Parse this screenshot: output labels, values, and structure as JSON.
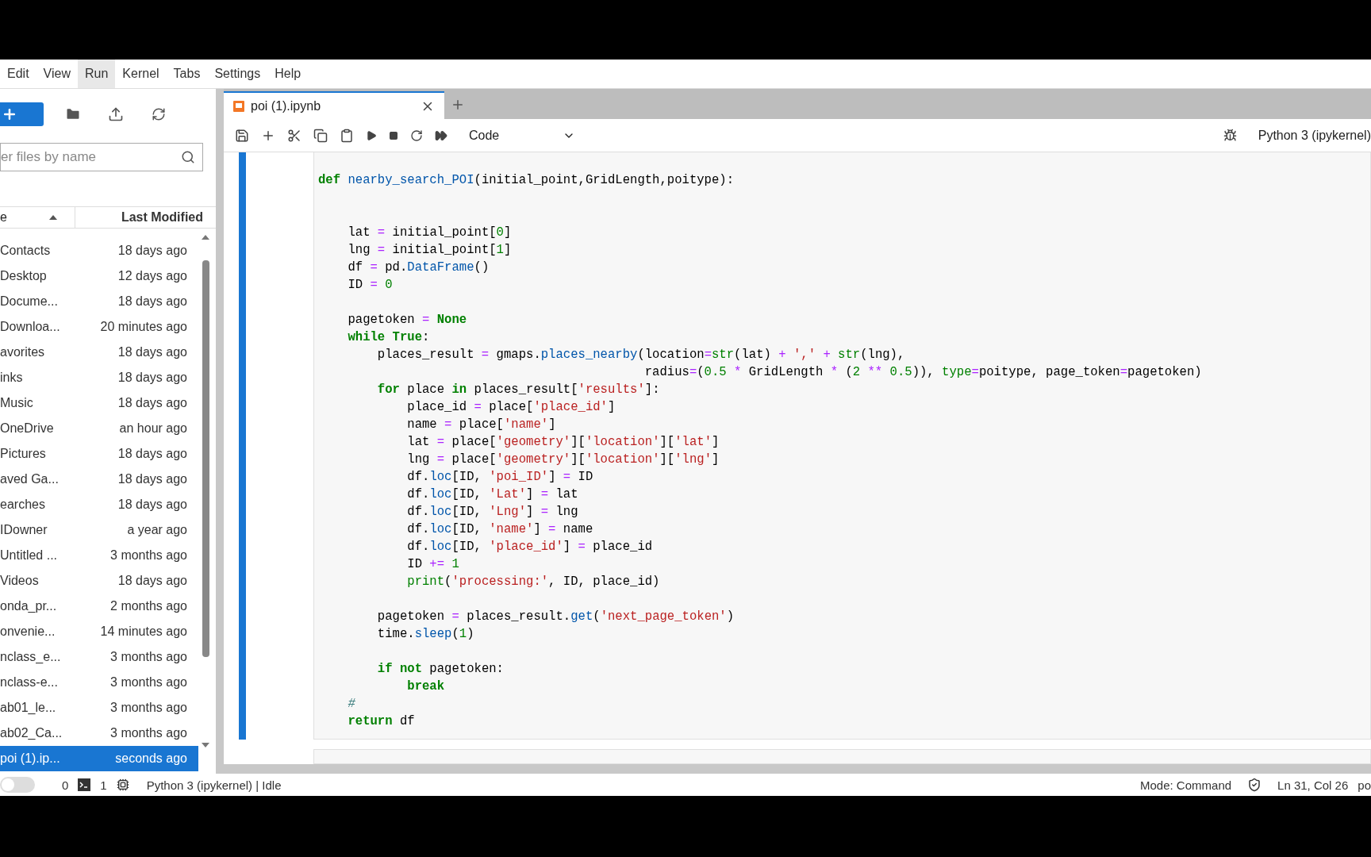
{
  "menu": [
    {
      "label": "Edit",
      "selected": false
    },
    {
      "label": "View",
      "selected": false
    },
    {
      "label": "Run",
      "selected": true
    },
    {
      "label": "Kernel",
      "selected": false
    },
    {
      "label": "Tabs",
      "selected": false
    },
    {
      "label": "Settings",
      "selected": false
    },
    {
      "label": "Help",
      "selected": false
    }
  ],
  "file_browser": {
    "filter": {
      "placeholder": "er files by name"
    },
    "columns": [
      "e",
      "Last Modified"
    ],
    "files": [
      {
        "name": "Contacts",
        "modified": "18 days ago",
        "selected": false
      },
      {
        "name": "Desktop",
        "modified": "12 days ago",
        "selected": false
      },
      {
        "name": "Docume...",
        "modified": "18 days ago",
        "selected": false
      },
      {
        "name": "Downloa...",
        "modified": "20 minutes ago",
        "selected": false
      },
      {
        "name": "avorites",
        "modified": "18 days ago",
        "selected": false
      },
      {
        "name": "inks",
        "modified": "18 days ago",
        "selected": false
      },
      {
        "name": "Music",
        "modified": "18 days ago",
        "selected": false
      },
      {
        "name": "OneDrive",
        "modified": "an hour ago",
        "selected": false
      },
      {
        "name": "Pictures",
        "modified": "18 days ago",
        "selected": false
      },
      {
        "name": "aved Ga...",
        "modified": "18 days ago",
        "selected": false
      },
      {
        "name": "earches",
        "modified": "18 days ago",
        "selected": false
      },
      {
        "name": "IDowner",
        "modified": "a year ago",
        "selected": false
      },
      {
        "name": "Untitled ...",
        "modified": "3 months ago",
        "selected": false
      },
      {
        "name": "Videos",
        "modified": "18 days ago",
        "selected": false
      },
      {
        "name": "onda_pr...",
        "modified": "2 months ago",
        "selected": false
      },
      {
        "name": "onvenie...",
        "modified": "14 minutes ago",
        "selected": false
      },
      {
        "name": "nclass_e...",
        "modified": "3 months ago",
        "selected": false
      },
      {
        "name": "nclass-e...",
        "modified": "3 months ago",
        "selected": false
      },
      {
        "name": "ab01_le...",
        "modified": "3 months ago",
        "selected": false
      },
      {
        "name": "ab02_Ca...",
        "modified": "3 months ago",
        "selected": false
      },
      {
        "name": "poi (1).ip...",
        "modified": "seconds ago",
        "selected": true
      }
    ]
  },
  "tab": {
    "title": "poi (1).ipynb"
  },
  "toolbar": {
    "cell_type": "Code",
    "kernel": "Python 3 (ipykernel)"
  },
  "cell": {
    "lines": [
      {
        "segments": [
          {
            "text": "def",
            "kind": "keyword"
          },
          {
            "text": " nearby_search_POI",
            "kind": "name"
          },
          {
            "text": "(initial_point,GridLength,poitype):",
            "kind": "plain"
          }
        ]
      },
      {
        "kind": "double_spaced",
        "segments": [
          {
            "text": "    lat",
            "kind": "plain"
          },
          {
            "text": " =",
            "kind": "operator"
          },
          {
            "text": " initial_point[",
            "kind": "plain"
          },
          {
            "text": "0",
            "kind": "number"
          },
          {
            "text": "]",
            "kind": "plain"
          }
        ]
      },
      {
        "segments": [
          {
            "text": "    lng",
            "kind": "plain"
          },
          {
            "text": " =",
            "kind": "operator"
          },
          {
            "text": " initial_point[",
            "kind": "plain"
          },
          {
            "text": "1",
            "kind": "number"
          },
          {
            "text": "]",
            "kind": "plain"
          }
        ]
      },
      {
        "segments": [
          {
            "text": "    df",
            "kind": "plain"
          },
          {
            "text": " =",
            "kind": "operator"
          },
          {
            "text": " pd.",
            "kind": "plain"
          },
          {
            "text": "DataFrame",
            "kind": "name"
          },
          {
            "text": "()",
            "kind": "plain"
          }
        ]
      },
      {
        "segments": [
          {
            "text": "    ID",
            "kind": "plain"
          },
          {
            "text": " =",
            "kind": "operator"
          },
          {
            "text": " 0",
            "kind": "number"
          }
        ]
      },
      {
        "kind": "spaced",
        "segments": [
          {
            "text": "    pagetoken",
            "kind": "plain"
          },
          {
            "text": " =",
            "kind": "operator"
          },
          {
            "text": " None",
            "kind": "keyword"
          }
        ]
      },
      {
        "segments": [
          {
            "text": "    while",
            "kind": "keyword"
          },
          {
            "text": " True",
            "kind": "keyword"
          },
          {
            "text": ":",
            "kind": "plain"
          }
        ]
      },
      {
        "segments": [
          {
            "text": "        places_result",
            "kind": "plain"
          },
          {
            "text": " =",
            "kind": "operator"
          },
          {
            "text": " gmaps.",
            "kind": "plain"
          },
          {
            "text": "places_nearby",
            "kind": "name"
          },
          {
            "text": "(location",
            "kind": "plain"
          },
          {
            "text": "=",
            "kind": "operator"
          },
          {
            "text": "str",
            "kind": "builtin"
          },
          {
            "text": "(lat)",
            "kind": "plain"
          },
          {
            "text": " +",
            "kind": "operator"
          },
          {
            "text": " ','",
            "kind": "string"
          },
          {
            "text": " +",
            "kind": "operator"
          },
          {
            "text": " str",
            "kind": "builtin"
          },
          {
            "text": "(lng),",
            "kind": "plain"
          }
        ]
      },
      {
        "segments": [
          {
            "text": "                                            radius",
            "kind": "plain"
          },
          {
            "text": "=",
            "kind": "operator"
          },
          {
            "text": "(",
            "kind": "plain"
          },
          {
            "text": "0.5",
            "kind": "number"
          },
          {
            "text": " *",
            "kind": "operator"
          },
          {
            "text": " GridLength",
            "kind": "plain"
          },
          {
            "text": " *",
            "kind": "operator"
          },
          {
            "text": " (",
            "kind": "plain"
          },
          {
            "text": "2",
            "kind": "number"
          },
          {
            "text": " **",
            "kind": "operator"
          },
          {
            "text": " 0.5",
            "kind": "number"
          },
          {
            "text": ")),",
            "kind": "plain"
          },
          {
            "text": " type",
            "kind": "builtin"
          },
          {
            "text": "=",
            "kind": "operator"
          },
          {
            "text": "poitype, page_token",
            "kind": "plain"
          },
          {
            "text": "=",
            "kind": "operator"
          },
          {
            "text": "pagetoken)",
            "kind": "plain"
          }
        ]
      },
      {
        "segments": [
          {
            "text": "        for",
            "kind": "keyword"
          },
          {
            "text": " place",
            "kind": "plain"
          },
          {
            "text": " in",
            "kind": "keyword"
          },
          {
            "text": " places_result[",
            "kind": "plain"
          },
          {
            "text": "'results'",
            "kind": "string"
          },
          {
            "text": "]:",
            "kind": "plain"
          }
        ]
      },
      {
        "segments": [
          {
            "text": "            place_id",
            "kind": "plain"
          },
          {
            "text": " =",
            "kind": "operator"
          },
          {
            "text": " place[",
            "kind": "plain"
          },
          {
            "text": "'place_id'",
            "kind": "string"
          },
          {
            "text": "]",
            "kind": "plain"
          }
        ]
      },
      {
        "segments": [
          {
            "text": "            name",
            "kind": "plain"
          },
          {
            "text": " =",
            "kind": "operator"
          },
          {
            "text": " place[",
            "kind": "plain"
          },
          {
            "text": "'name'",
            "kind": "string"
          },
          {
            "text": "]",
            "kind": "plain"
          }
        ]
      },
      {
        "segments": [
          {
            "text": "            lat",
            "kind": "plain"
          },
          {
            "text": " =",
            "kind": "operator"
          },
          {
            "text": " place[",
            "kind": "plain"
          },
          {
            "text": "'geometry'",
            "kind": "string"
          },
          {
            "text": "][",
            "kind": "plain"
          },
          {
            "text": "'location'",
            "kind": "string"
          },
          {
            "text": "][",
            "kind": "plain"
          },
          {
            "text": "'lat'",
            "kind": "string"
          },
          {
            "text": "]",
            "kind": "plain"
          }
        ]
      },
      {
        "segments": [
          {
            "text": "            lng",
            "kind": "plain"
          },
          {
            "text": " =",
            "kind": "operator"
          },
          {
            "text": " place[",
            "kind": "plain"
          },
          {
            "text": "'geometry'",
            "kind": "string"
          },
          {
            "text": "][",
            "kind": "plain"
          },
          {
            "text": "'location'",
            "kind": "string"
          },
          {
            "text": "][",
            "kind": "plain"
          },
          {
            "text": "'lng'",
            "kind": "string"
          },
          {
            "text": "]",
            "kind": "plain"
          }
        ]
      },
      {
        "segments": [
          {
            "text": "            df.",
            "kind": "plain"
          },
          {
            "text": "loc",
            "kind": "name"
          },
          {
            "text": "[ID,",
            "kind": "plain"
          },
          {
            "text": " 'poi_ID'",
            "kind": "string"
          },
          {
            "text": "]",
            "kind": "plain"
          },
          {
            "text": " =",
            "kind": "operator"
          },
          {
            "text": " ID",
            "kind": "plain"
          }
        ]
      },
      {
        "segments": [
          {
            "text": "            df.",
            "kind": "plain"
          },
          {
            "text": "loc",
            "kind": "name"
          },
          {
            "text": "[ID,",
            "kind": "plain"
          },
          {
            "text": " 'Lat'",
            "kind": "string"
          },
          {
            "text": "]",
            "kind": "plain"
          },
          {
            "text": " =",
            "kind": "operator"
          },
          {
            "text": " lat",
            "kind": "plain"
          }
        ]
      },
      {
        "segments": [
          {
            "text": "            df.",
            "kind": "plain"
          },
          {
            "text": "loc",
            "kind": "name"
          },
          {
            "text": "[ID,",
            "kind": "plain"
          },
          {
            "text": " 'Lng'",
            "kind": "string"
          },
          {
            "text": "]",
            "kind": "plain"
          },
          {
            "text": " =",
            "kind": "operator"
          },
          {
            "text": " lng",
            "kind": "plain"
          }
        ]
      },
      {
        "segments": [
          {
            "text": "            df.",
            "kind": "plain"
          },
          {
            "text": "loc",
            "kind": "name"
          },
          {
            "text": "[ID,",
            "kind": "plain"
          },
          {
            "text": " 'name'",
            "kind": "string"
          },
          {
            "text": "]",
            "kind": "plain"
          },
          {
            "text": " =",
            "kind": "operator"
          },
          {
            "text": " name",
            "kind": "plain"
          }
        ]
      },
      {
        "segments": [
          {
            "text": "            df.",
            "kind": "plain"
          },
          {
            "text": "loc",
            "kind": "name"
          },
          {
            "text": "[ID,",
            "kind": "plain"
          },
          {
            "text": " 'place_id'",
            "kind": "string"
          },
          {
            "text": "]",
            "kind": "plain"
          },
          {
            "text": " =",
            "kind": "operator"
          },
          {
            "text": " place_id",
            "kind": "plain"
          }
        ]
      },
      {
        "segments": [
          {
            "text": "            ID",
            "kind": "plain"
          },
          {
            "text": " +=",
            "kind": "operator"
          },
          {
            "text": " 1",
            "kind": "number"
          }
        ]
      },
      {
        "segments": [
          {
            "text": "            print",
            "kind": "builtin"
          },
          {
            "text": "(",
            "kind": "plain"
          },
          {
            "text": "'processing:'",
            "kind": "string"
          },
          {
            "text": ", ID, place_id)",
            "kind": "plain"
          }
        ]
      },
      {
        "kind": "spaced",
        "segments": [
          {
            "text": "        pagetoken",
            "kind": "plain"
          },
          {
            "text": " =",
            "kind": "operator"
          },
          {
            "text": " places_result.",
            "kind": "plain"
          },
          {
            "text": "get",
            "kind": "name"
          },
          {
            "text": "(",
            "kind": "plain"
          },
          {
            "text": "'next_page_token'",
            "kind": "string"
          },
          {
            "text": ")",
            "kind": "plain"
          }
        ]
      },
      {
        "segments": [
          {
            "text": "        time.",
            "kind": "plain"
          },
          {
            "text": "sleep",
            "kind": "name"
          },
          {
            "text": "(",
            "kind": "plain"
          },
          {
            "text": "1",
            "kind": "number"
          },
          {
            "text": ")",
            "kind": "plain"
          }
        ]
      },
      {
        "kind": "spaced",
        "segments": [
          {
            "text": "        if",
            "kind": "keyword"
          },
          {
            "text": " not",
            "kind": "keyword"
          },
          {
            "text": " pagetoken:",
            "kind": "plain"
          }
        ]
      },
      {
        "segments": [
          {
            "text": "            break",
            "kind": "keyword"
          }
        ]
      },
      {
        "segments": [
          {
            "text": "    #",
            "kind": "comment"
          }
        ]
      },
      {
        "segments": [
          {
            "text": "    return",
            "kind": "keyword"
          },
          {
            "text": " df",
            "kind": "plain"
          }
        ]
      }
    ]
  },
  "status_bar": {
    "simple_mode": {
      "on": false
    },
    "terminals": "0",
    "kernels": "1",
    "kernel_status": "Python 3 (ipykernel) | Idle",
    "mode": "Mode: Command",
    "cursor": "Ln 31, Col 26",
    "file": "po"
  }
}
